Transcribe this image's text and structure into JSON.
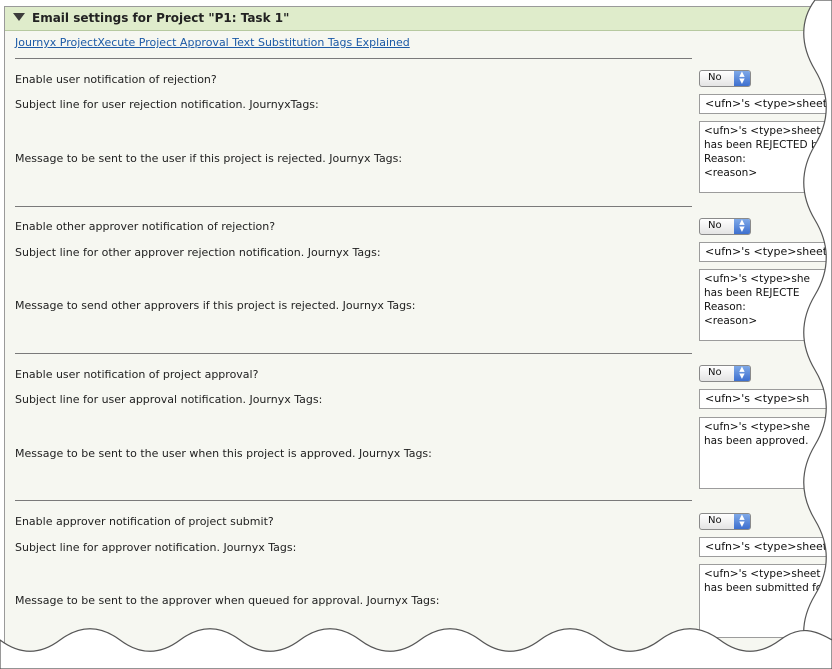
{
  "header": {
    "title": "Email settings for Project \"P1: Task 1\"",
    "collapse_icon": "triangle-down-icon"
  },
  "help_link": "Journyx ProjectXecute Project Approval Text Substitution Tags Explained",
  "sections": [
    {
      "enable_label": "Enable user notification of rejection?",
      "enable_value": "No",
      "subject_label": "Subject line for user rejection notification. JournyxTags:",
      "subject_value": "<ufn>'s <type>sheet",
      "message_label": "Message to be sent to the user if this project is rejected. Journyx Tags:",
      "message_lines": [
        "<ufn>'s <type>sheet f",
        "has been REJECTED by",
        "Reason:",
        "<reason>"
      ]
    },
    {
      "enable_label": "Enable other approver notification of rejection?",
      "enable_value": "No",
      "subject_label": "Subject line for other approver rejection notification. Journyx Tags:",
      "subject_value": "<ufn>'s <type>sheet",
      "message_label": "Message to send other approvers if this project is rejected. Journyx Tags:",
      "message_lines": [
        "<ufn>'s <type>she",
        "has been REJECTE",
        "Reason:",
        "<reason>"
      ]
    },
    {
      "enable_label": "Enable user notification of project approval?",
      "enable_value": "No",
      "subject_label": "Subject line for user approval notification. Journyx Tags:",
      "subject_value": "<ufn>'s <type>sh",
      "message_label": "Message to be sent to the user when this project is approved. Journyx Tags:",
      "message_lines": [
        "<ufn>'s <type>she",
        "has been approved."
      ]
    },
    {
      "enable_label": "Enable approver notification of project submit?",
      "enable_value": "No",
      "subject_label": "Subject line for approver notification. Journyx Tags:",
      "subject_value": "<ufn>'s <type>sheet",
      "message_label": "Message to be sent to the approver when queued for approval. Journyx Tags:",
      "message_lines": [
        "<ufn>'s <type>sheet f",
        "has been submitted fo"
      ]
    }
  ]
}
